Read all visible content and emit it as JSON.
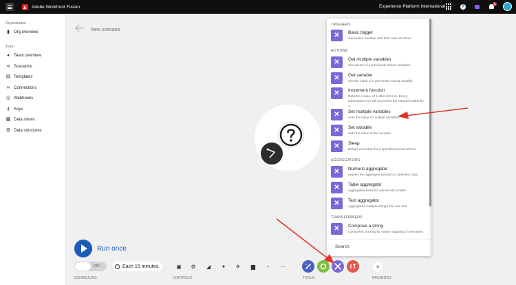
{
  "topbar": {
    "app_title": "Adobe Workfront Fusion",
    "org_name": "Experience Platform International",
    "notification_count": "1"
  },
  "sidebar": {
    "org_section": "Organization",
    "org_items": [
      {
        "label": "Org overview",
        "icon": "bar-chart-icon"
      }
    ],
    "team_section": "Team",
    "team_items": [
      {
        "label": "Team overview",
        "icon": "team-icon"
      },
      {
        "label": "Scenarios",
        "icon": "share-icon"
      },
      {
        "label": "Templates",
        "icon": "templates-icon"
      },
      {
        "label": "Connections",
        "icon": "link-icon"
      },
      {
        "label": "Webhooks",
        "icon": "globe-icon"
      },
      {
        "label": "Keys",
        "icon": "key-icon"
      },
      {
        "label": "Data stores",
        "icon": "database-icon"
      },
      {
        "label": "Data structures",
        "icon": "data-structure-icon"
      }
    ]
  },
  "canvas": {
    "scenario_name": "New scenario"
  },
  "toolbar": {
    "run_label": "Run once",
    "toggle_state": "OFF",
    "schedule_text": "Each 15 minutes.",
    "scheduling_label": "SCHEDULING",
    "controls_label": "CONTROLS",
    "tools_label": "TOOLS",
    "favorites_label": "FAVORITES",
    "tool_colors": {
      "flow": "#4a5fc1",
      "tools": "#7cbf3f",
      "active": "#7c67d6",
      "text": "#e2574c"
    }
  },
  "panel": {
    "triggers": "TRIGGERS",
    "actions": "ACTIONS",
    "aggregators": "AGGREGATORS",
    "transformers": "TRANSFORMERS",
    "search_placeholder": "Search",
    "items": [
      {
        "title": "Basic trigger",
        "desc": "Generates bundles with their own structure."
      },
      {
        "title": "Get multiple variables",
        "desc": "Get values of a previously stored variables."
      },
      {
        "title": "Get variable",
        "desc": "Get the value of a previously stored variable."
      },
      {
        "title": "Increment function",
        "desc": "Returns a value of 1 after first run. Every subsequent run will increment the returned value by 1."
      },
      {
        "title": "Set multiple variables",
        "desc": "Sets the value of multiple variables."
      },
      {
        "title": "Set variable",
        "desc": "Sets the value of the variable."
      },
      {
        "title": "Sleep",
        "desc": "Delays execution for a specified period of time."
      },
      {
        "title": "Numeric aggregator",
        "desc": "Applies the aggregate function to selected rows."
      },
      {
        "title": "Table aggregator",
        "desc": "Aggregates selected values into a table."
      },
      {
        "title": "Text aggregator",
        "desc": "Aggregates multiple strings into one text."
      },
      {
        "title": "Compose a string",
        "desc": "Composes a string for easier mapping of scenarios."
      }
    ]
  },
  "colors": {
    "accent": "#1c5bb8",
    "module": "#7c67d6",
    "annotation": "#e0342a"
  }
}
